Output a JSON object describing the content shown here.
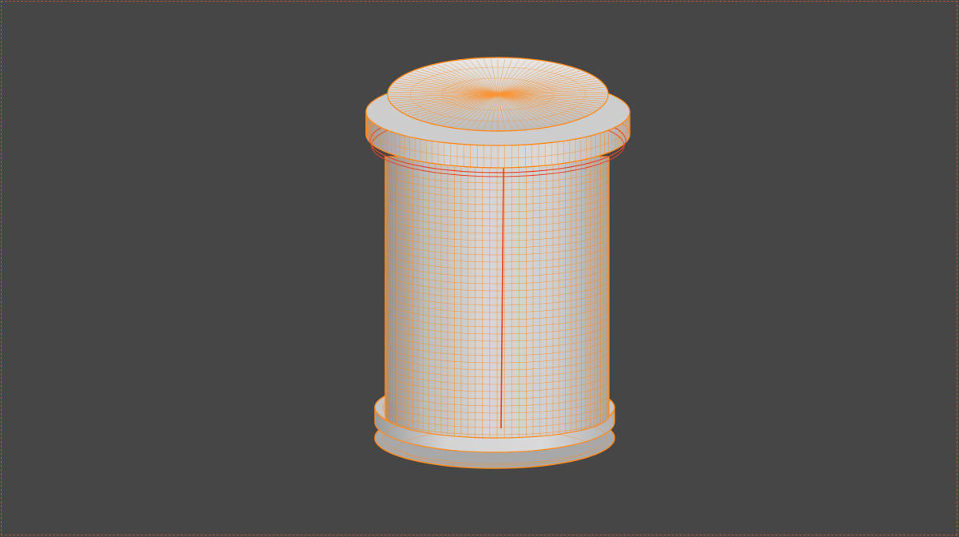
{
  "viewport": {
    "background": "#464646",
    "frame_color": "#b85a3a"
  },
  "object": {
    "type": "cylinder-spool-mesh",
    "shading_color": "#c9c9c9",
    "wire_color": "#ff8a1c",
    "seam_color": "#e8452a",
    "selection_highlight": "#ff7a1a"
  }
}
